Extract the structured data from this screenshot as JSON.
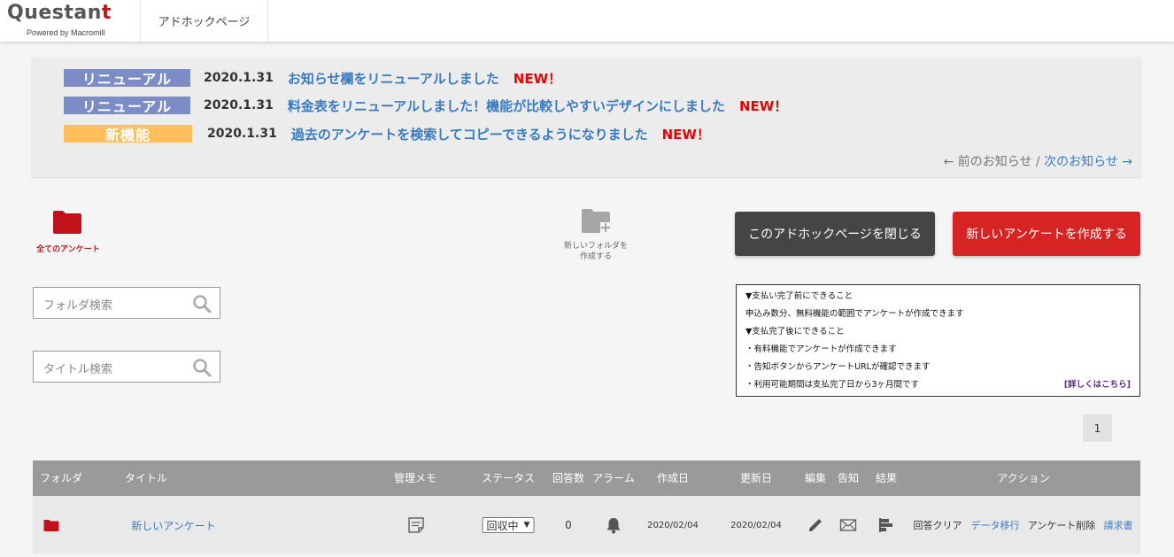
{
  "header": {
    "logo_text": "Questant",
    "logo_tagline": "Powered by Macromill",
    "page_label": "アドホックページ"
  },
  "news": {
    "items": [
      {
        "badge": "リニューアル",
        "badge_color": "#7b8cc7",
        "date": "2020.1.31",
        "text": "お知らせ欄をリニューアルしました",
        "new_label": "NEW！"
      },
      {
        "badge": "リニューアル",
        "badge_color": "#7b8cc7",
        "date": "2020.1.31",
        "text": "料金表をリニューアルしました！機能が比較しやすいデザインにしました",
        "new_label": "NEW！"
      },
      {
        "badge": "新機能",
        "badge_color": "#ffbe5c",
        "date": "2020.1.31",
        "text": "過去のアンケートを検索してコピーできるようになりました",
        "new_label": "NEW！"
      }
    ],
    "prev_label": "← 前のお知らせ",
    "separator": " / ",
    "next_label": "次のお知らせ →"
  },
  "folders": {
    "all_label": "全てのアンケート",
    "new_folder_line1": "新しいフォルダを",
    "new_folder_line2": "作成する"
  },
  "actions": {
    "close_page": "このアドホックページを閉じる",
    "create_survey": "新しいアンケートを作成する"
  },
  "search": {
    "folder_placeholder": "フォルダ検索",
    "title_placeholder": "タイトル検索"
  },
  "info": {
    "lines": [
      "▼支払い完了前にできること",
      "申込み数分、無料機能の範囲でアンケートが作成できます",
      "▼支払完了後にできること",
      "・有料機能でアンケートが作成できます",
      "・告知ボタンからアンケートURLが確認できます",
      "・利用可能期間は支払完了日から3ヶ月間です"
    ],
    "link": "[詳しくはこちら]"
  },
  "pagination": {
    "current": "1"
  },
  "table": {
    "headers": {
      "folder": "フォルダ",
      "title": "タイトル",
      "memo": "管理メモ",
      "status": "ステータス",
      "responses": "回答数",
      "alarm": "アラーム",
      "created": "作成日",
      "updated": "更新日",
      "edit": "編集",
      "notice": "告知",
      "result": "結果",
      "action": "アクション"
    },
    "row": {
      "title": "新しいアンケート",
      "status": "回収中",
      "responses": "0",
      "created": "2020/02/04",
      "updated": "2020/02/04",
      "action_clear": "回答クリア",
      "action_migrate": "データ移行",
      "action_delete": "アンケート削除",
      "action_invoice": "請求書"
    }
  },
  "colors": {
    "brand_red": "#c0121a",
    "link_blue": "#3a7bc0",
    "new_red": "#e00000",
    "close_button": "#454545",
    "create_button": "#d62323"
  }
}
